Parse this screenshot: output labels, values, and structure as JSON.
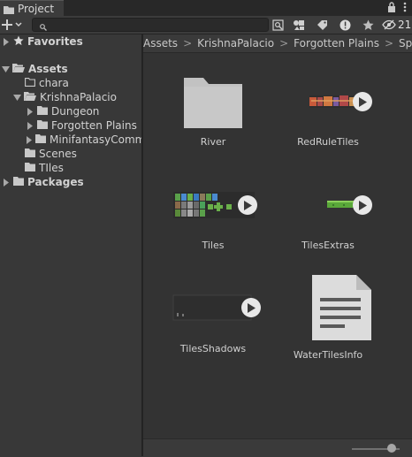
{
  "tab": {
    "title": "Project"
  },
  "toolbar": {
    "search_placeholder": "",
    "hidden_count": "21"
  },
  "tree": {
    "favorites": "Favorites",
    "assets": "Assets",
    "chara": "chara",
    "krishna": "KrishnaPalacio",
    "dungeon": "Dungeon",
    "forgotten": "Forgotten Plains",
    "minifantasy": "MinifantasyComm",
    "scenes": "Scenes",
    "tiles": "TIles",
    "packages": "Packages"
  },
  "breadcrumb": [
    "Assets",
    "KrishnaPalacio",
    "Forgotten Plains",
    "Sprites"
  ],
  "assets": [
    {
      "name": "River",
      "kind": "folder"
    },
    {
      "name": "RedRuleTiles",
      "kind": "spritesheet"
    },
    {
      "name": "Tiles",
      "kind": "spritesheet"
    },
    {
      "name": "TilesExtras",
      "kind": "spritesheet"
    },
    {
      "name": "TilesShadows",
      "kind": "spritesheet"
    },
    {
      "name": "WaterTilesInfo",
      "kind": "document"
    }
  ],
  "colors": {
    "background": "#383838",
    "panel": "#333333",
    "accent": "#e8e8e8"
  },
  "zoom_slider_value": 0.74
}
